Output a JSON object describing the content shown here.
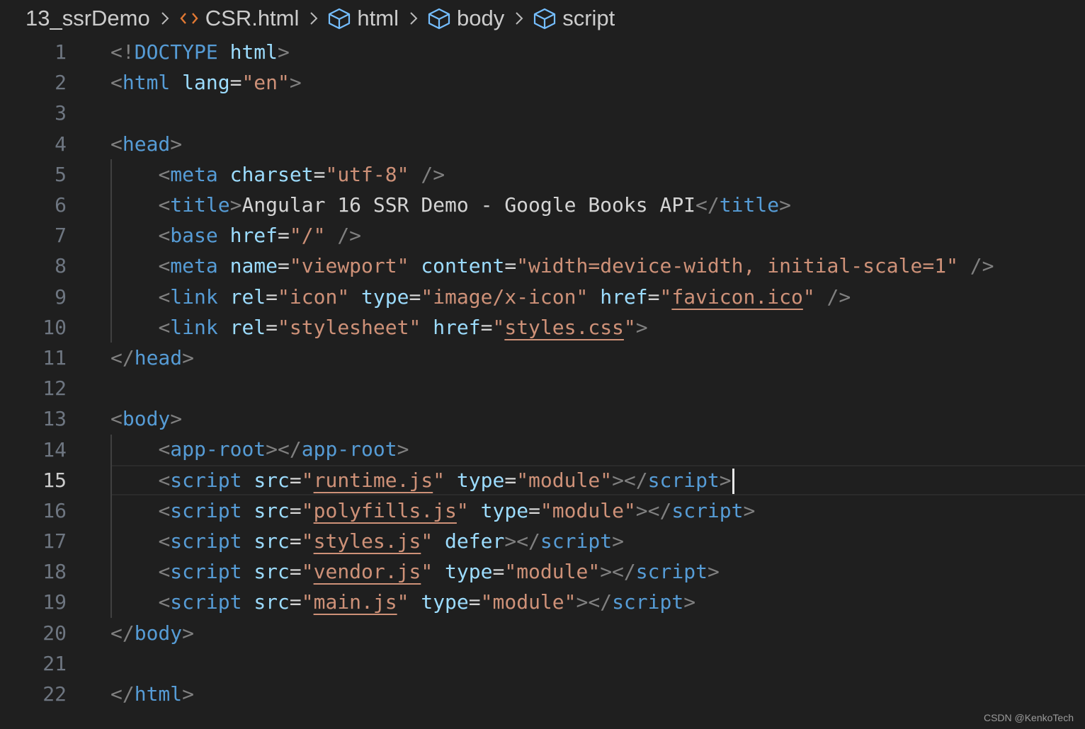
{
  "breadcrumb": {
    "folder": "13_ssrDemo",
    "file": "CSR.html",
    "symbols": [
      "html",
      "body",
      "script"
    ]
  },
  "editor": {
    "current_line": 15,
    "lines": [
      {
        "n": "1",
        "tokens": [
          [
            "p",
            "<!"
          ],
          [
            "tg",
            "DOCTYPE"
          ],
          [
            "tx",
            " "
          ],
          [
            "at",
            "html"
          ],
          [
            "p",
            ">"
          ]
        ]
      },
      {
        "n": "2",
        "tokens": [
          [
            "p",
            "<"
          ],
          [
            "tg",
            "html"
          ],
          [
            "tx",
            " "
          ],
          [
            "at",
            "lang"
          ],
          [
            "tx",
            "="
          ],
          [
            "st",
            "\"en\""
          ],
          [
            "p",
            ">"
          ]
        ]
      },
      {
        "n": "3",
        "tokens": []
      },
      {
        "n": "4",
        "tokens": [
          [
            "p",
            "<"
          ],
          [
            "tg",
            "head"
          ],
          [
            "p",
            ">"
          ]
        ]
      },
      {
        "n": "5",
        "tokens": [
          [
            "tx",
            "    "
          ],
          [
            "p",
            "<"
          ],
          [
            "tg",
            "meta"
          ],
          [
            "tx",
            " "
          ],
          [
            "at",
            "charset"
          ],
          [
            "tx",
            "="
          ],
          [
            "st",
            "\"utf-8\""
          ],
          [
            "tx",
            " "
          ],
          [
            "p",
            "/>"
          ]
        ]
      },
      {
        "n": "6",
        "tokens": [
          [
            "tx",
            "    "
          ],
          [
            "p",
            "<"
          ],
          [
            "tg",
            "title"
          ],
          [
            "p",
            ">"
          ],
          [
            "tx",
            "Angular 16 SSR Demo - Google Books API"
          ],
          [
            "p",
            "</"
          ],
          [
            "tg",
            "title"
          ],
          [
            "p",
            ">"
          ]
        ]
      },
      {
        "n": "7",
        "tokens": [
          [
            "tx",
            "    "
          ],
          [
            "p",
            "<"
          ],
          [
            "tg",
            "base"
          ],
          [
            "tx",
            " "
          ],
          [
            "at",
            "href"
          ],
          [
            "tx",
            "="
          ],
          [
            "st",
            "\"/\""
          ],
          [
            "tx",
            " "
          ],
          [
            "p",
            "/>"
          ]
        ]
      },
      {
        "n": "8",
        "tokens": [
          [
            "tx",
            "    "
          ],
          [
            "p",
            "<"
          ],
          [
            "tg",
            "meta"
          ],
          [
            "tx",
            " "
          ],
          [
            "at",
            "name"
          ],
          [
            "tx",
            "="
          ],
          [
            "st",
            "\"viewport\""
          ],
          [
            "tx",
            " "
          ],
          [
            "at",
            "content"
          ],
          [
            "tx",
            "="
          ],
          [
            "st",
            "\"width=device-width, initial-scale=1\""
          ],
          [
            "tx",
            " "
          ],
          [
            "p",
            "/>"
          ]
        ]
      },
      {
        "n": "9",
        "tokens": [
          [
            "tx",
            "    "
          ],
          [
            "p",
            "<"
          ],
          [
            "tg",
            "link"
          ],
          [
            "tx",
            " "
          ],
          [
            "at",
            "rel"
          ],
          [
            "tx",
            "="
          ],
          [
            "st",
            "\"icon\""
          ],
          [
            "tx",
            " "
          ],
          [
            "at",
            "type"
          ],
          [
            "tx",
            "="
          ],
          [
            "st",
            "\"image/x-icon\""
          ],
          [
            "tx",
            " "
          ],
          [
            "at",
            "href"
          ],
          [
            "tx",
            "="
          ],
          [
            "st",
            "\""
          ],
          [
            "stu",
            "favicon.ico"
          ],
          [
            "st",
            "\""
          ],
          [
            "tx",
            " "
          ],
          [
            "p",
            "/>"
          ]
        ]
      },
      {
        "n": "10",
        "tokens": [
          [
            "tx",
            "    "
          ],
          [
            "p",
            "<"
          ],
          [
            "tg",
            "link"
          ],
          [
            "tx",
            " "
          ],
          [
            "at",
            "rel"
          ],
          [
            "tx",
            "="
          ],
          [
            "st",
            "\"stylesheet\""
          ],
          [
            "tx",
            " "
          ],
          [
            "at",
            "href"
          ],
          [
            "tx",
            "="
          ],
          [
            "st",
            "\""
          ],
          [
            "stu",
            "styles.css"
          ],
          [
            "st",
            "\""
          ],
          [
            "p",
            ">"
          ]
        ]
      },
      {
        "n": "11",
        "tokens": [
          [
            "p",
            "</"
          ],
          [
            "tg",
            "head"
          ],
          [
            "p",
            ">"
          ]
        ]
      },
      {
        "n": "12",
        "tokens": []
      },
      {
        "n": "13",
        "tokens": [
          [
            "p",
            "<"
          ],
          [
            "tg",
            "body"
          ],
          [
            "p",
            ">"
          ]
        ]
      },
      {
        "n": "14",
        "tokens": [
          [
            "tx",
            "    "
          ],
          [
            "p",
            "<"
          ],
          [
            "tg",
            "app-root"
          ],
          [
            "p",
            "></"
          ],
          [
            "tg",
            "app-root"
          ],
          [
            "p",
            ">"
          ]
        ]
      },
      {
        "n": "15",
        "tokens": [
          [
            "tx",
            "    "
          ],
          [
            "p",
            "<"
          ],
          [
            "tg",
            "script"
          ],
          [
            "tx",
            " "
          ],
          [
            "at",
            "src"
          ],
          [
            "tx",
            "="
          ],
          [
            "st",
            "\""
          ],
          [
            "stu",
            "runtime.js"
          ],
          [
            "st",
            "\""
          ],
          [
            "tx",
            " "
          ],
          [
            "at",
            "type"
          ],
          [
            "tx",
            "="
          ],
          [
            "st",
            "\"module\""
          ],
          [
            "p",
            "></"
          ],
          [
            "tg",
            "script"
          ],
          [
            "p",
            ">"
          ]
        ]
      },
      {
        "n": "16",
        "tokens": [
          [
            "tx",
            "    "
          ],
          [
            "p",
            "<"
          ],
          [
            "tg",
            "script"
          ],
          [
            "tx",
            " "
          ],
          [
            "at",
            "src"
          ],
          [
            "tx",
            "="
          ],
          [
            "st",
            "\""
          ],
          [
            "stu",
            "polyfills.js"
          ],
          [
            "st",
            "\""
          ],
          [
            "tx",
            " "
          ],
          [
            "at",
            "type"
          ],
          [
            "tx",
            "="
          ],
          [
            "st",
            "\"module\""
          ],
          [
            "p",
            "></"
          ],
          [
            "tg",
            "script"
          ],
          [
            "p",
            ">"
          ]
        ]
      },
      {
        "n": "17",
        "tokens": [
          [
            "tx",
            "    "
          ],
          [
            "p",
            "<"
          ],
          [
            "tg",
            "script"
          ],
          [
            "tx",
            " "
          ],
          [
            "at",
            "src"
          ],
          [
            "tx",
            "="
          ],
          [
            "st",
            "\""
          ],
          [
            "stu",
            "styles.js"
          ],
          [
            "st",
            "\""
          ],
          [
            "tx",
            " "
          ],
          [
            "at",
            "defer"
          ],
          [
            "p",
            "></"
          ],
          [
            "tg",
            "script"
          ],
          [
            "p",
            ">"
          ]
        ]
      },
      {
        "n": "18",
        "tokens": [
          [
            "tx",
            "    "
          ],
          [
            "p",
            "<"
          ],
          [
            "tg",
            "script"
          ],
          [
            "tx",
            " "
          ],
          [
            "at",
            "src"
          ],
          [
            "tx",
            "="
          ],
          [
            "st",
            "\""
          ],
          [
            "stu",
            "vendor.js"
          ],
          [
            "st",
            "\""
          ],
          [
            "tx",
            " "
          ],
          [
            "at",
            "type"
          ],
          [
            "tx",
            "="
          ],
          [
            "st",
            "\"module\""
          ],
          [
            "p",
            "></"
          ],
          [
            "tg",
            "script"
          ],
          [
            "p",
            ">"
          ]
        ]
      },
      {
        "n": "19",
        "tokens": [
          [
            "tx",
            "    "
          ],
          [
            "p",
            "<"
          ],
          [
            "tg",
            "script"
          ],
          [
            "tx",
            " "
          ],
          [
            "at",
            "src"
          ],
          [
            "tx",
            "="
          ],
          [
            "st",
            "\""
          ],
          [
            "stu",
            "main.js"
          ],
          [
            "st",
            "\""
          ],
          [
            "tx",
            " "
          ],
          [
            "at",
            "type"
          ],
          [
            "tx",
            "="
          ],
          [
            "st",
            "\"module\""
          ],
          [
            "p",
            "></"
          ],
          [
            "tg",
            "script"
          ],
          [
            "p",
            ">"
          ]
        ]
      },
      {
        "n": "20",
        "tokens": [
          [
            "p",
            "</"
          ],
          [
            "tg",
            "body"
          ],
          [
            "p",
            ">"
          ]
        ]
      },
      {
        "n": "21",
        "tokens": []
      },
      {
        "n": "22",
        "tokens": [
          [
            "p",
            "</"
          ],
          [
            "tg",
            "html"
          ],
          [
            "p",
            ">"
          ]
        ]
      }
    ]
  },
  "watermark": "CSDN @KenkoTech",
  "colors": {
    "background": "#1f1f1f",
    "tag": "#569cd6",
    "attribute": "#9cdcfe",
    "string": "#ce9178",
    "punctuation": "#808080",
    "text": "#d4d4d4",
    "file_icon": "#e37933",
    "symbol_icon": "#75beff"
  },
  "icons": {
    "file": "html-file-icon",
    "symbol": "symbol-element-icon",
    "separator": "chevron-right-icon"
  }
}
